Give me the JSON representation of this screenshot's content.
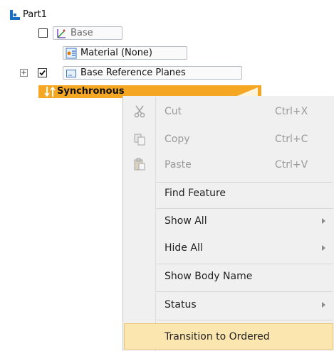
{
  "tree": {
    "root_label": "Part1",
    "base_label": "Base",
    "material_label": "Material (None)",
    "ref_planes_label": "Base Reference Planes",
    "synchronous_label": "Synchronous",
    "base_checked": false,
    "ref_planes_checked": true,
    "expander_symbol": "+",
    "colors": {
      "selection_bg": "#f5a623",
      "node_border": "#b8bcc4"
    }
  },
  "context_menu": {
    "items": [
      {
        "label": "Cut",
        "shortcut": "Ctrl+X",
        "disabled": true,
        "icon": "scissors-icon"
      },
      {
        "label": "Copy",
        "shortcut": "Ctrl+C",
        "disabled": true,
        "icon": "copy-icon"
      },
      {
        "label": "Paste",
        "shortcut": "Ctrl+V",
        "disabled": true,
        "icon": "paste-icon"
      },
      {
        "label": "Find Feature"
      },
      {
        "label": "Show All",
        "submenu": true
      },
      {
        "label": "Hide All",
        "submenu": true
      },
      {
        "label": "Show Body Name"
      },
      {
        "label": "Status",
        "submenu": true
      },
      {
        "label": "Transition to Ordered",
        "highlighted": true
      }
    ],
    "colors": {
      "background": "#f0f0f0",
      "highlight_bg": "#fce6b0",
      "highlight_border": "#eac773"
    }
  }
}
